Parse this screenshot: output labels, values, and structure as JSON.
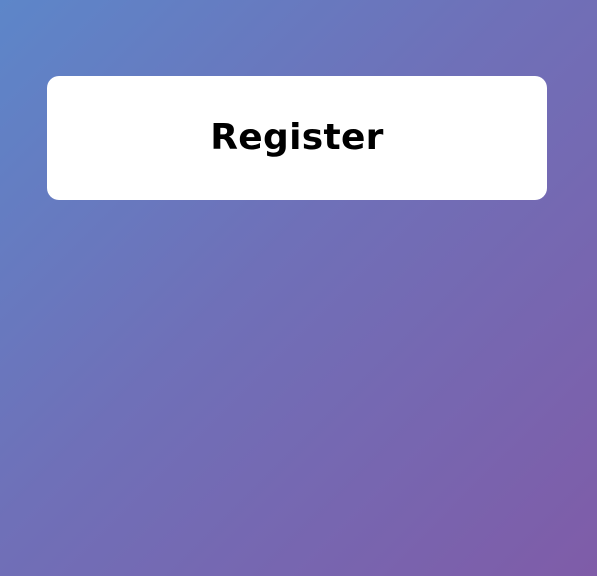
{
  "register_card": {
    "title": "Register"
  },
  "colors": {
    "background_gradient_start": "#5d86c9",
    "background_gradient_mid": "#6f70b8",
    "background_gradient_end": "#7f5ca8",
    "card_background": "#ffffff",
    "title_text": "#000000"
  }
}
